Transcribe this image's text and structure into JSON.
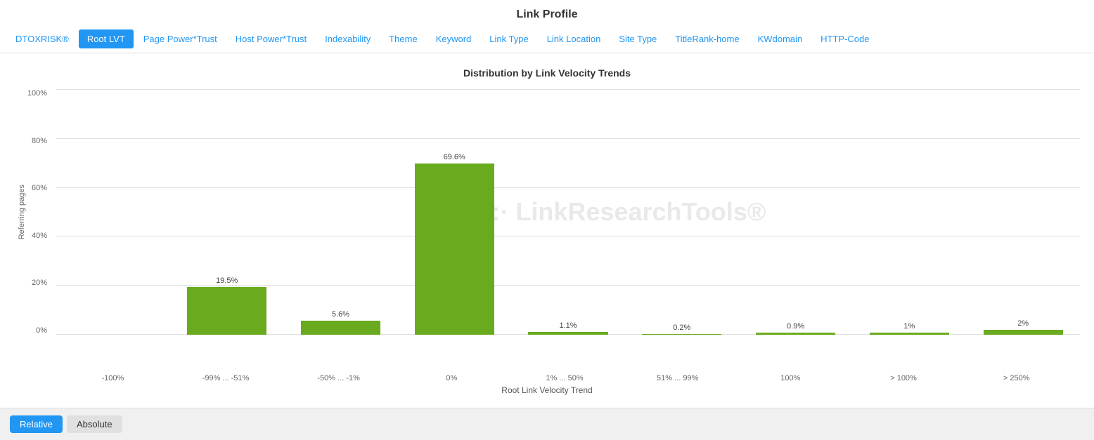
{
  "page": {
    "title": "Link Profile"
  },
  "nav": {
    "items": [
      {
        "label": "DTOXRISK®",
        "active": false,
        "id": "dtoxrisk"
      },
      {
        "label": "Root LVT",
        "active": true,
        "id": "root-lvt"
      },
      {
        "label": "Page Power*Trust",
        "active": false,
        "id": "page-power-trust"
      },
      {
        "label": "Host Power*Trust",
        "active": false,
        "id": "host-power-trust"
      },
      {
        "label": "Indexability",
        "active": false,
        "id": "indexability"
      },
      {
        "label": "Theme",
        "active": false,
        "id": "theme"
      },
      {
        "label": "Keyword",
        "active": false,
        "id": "keyword"
      },
      {
        "label": "Link Type",
        "active": false,
        "id": "link-type"
      },
      {
        "label": "Link Location",
        "active": false,
        "id": "link-location"
      },
      {
        "label": "Site Type",
        "active": false,
        "id": "site-type"
      },
      {
        "label": "TitleRank-home",
        "active": false,
        "id": "titlerank-home"
      },
      {
        "label": "KWdomain",
        "active": false,
        "id": "kwdomain"
      },
      {
        "label": "HTTP-Code",
        "active": false,
        "id": "http-code"
      }
    ]
  },
  "chart": {
    "title": "Distribution by Link Velocity Trends",
    "y_axis_title": "Referring pages",
    "x_axis_title": "Root Link Velocity Trend",
    "y_labels": [
      "100%",
      "80%",
      "60%",
      "40%",
      "20%",
      "0%"
    ],
    "watermark": "·:· LinkResearchTools®",
    "bars": [
      {
        "x_label": "-100%",
        "value": 0,
        "pct": 0,
        "label": ""
      },
      {
        "x_label": "-99% ... -51%",
        "value": 19.5,
        "pct": 19.5,
        "label": "19.5%"
      },
      {
        "x_label": "-50% ... -1%",
        "value": 5.6,
        "pct": 5.6,
        "label": "5.6%"
      },
      {
        "x_label": "0%",
        "value": 69.6,
        "pct": 69.6,
        "label": "69.6%"
      },
      {
        "x_label": "1% ... 50%",
        "value": 1.1,
        "pct": 1.1,
        "label": "1.1%"
      },
      {
        "x_label": "51% ... 99%",
        "value": 0.2,
        "pct": 0.2,
        "label": "0.2%"
      },
      {
        "x_label": "100%",
        "value": 0.9,
        "pct": 0.9,
        "label": "0.9%"
      },
      {
        "x_label": "> 100%",
        "value": 1,
        "pct": 1,
        "label": "1%"
      },
      {
        "x_label": "> 250%",
        "value": 2,
        "pct": 2,
        "label": "2%"
      }
    ]
  },
  "bottom": {
    "relative_label": "Relative",
    "absolute_label": "Absolute"
  }
}
